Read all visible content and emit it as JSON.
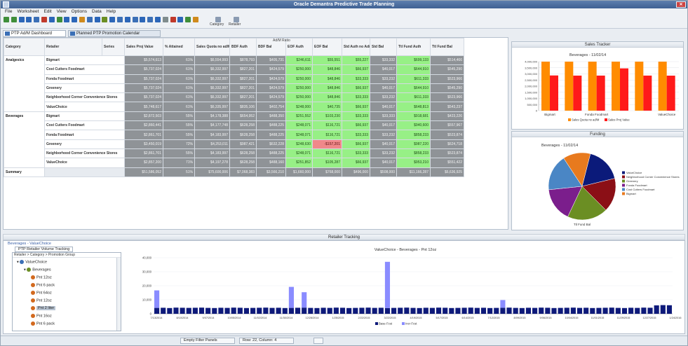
{
  "window": {
    "title": "Oracle Demantra Predictive Trade Planning"
  },
  "menu": [
    "File",
    "Worksheet",
    "Edit",
    "View",
    "Options",
    "Data",
    "Help"
  ],
  "toolbar": {
    "btn1_label": "Category",
    "btn2_label": "Retailer"
  },
  "doc_tabs": [
    {
      "label": "PTP Ad/M Dashboard",
      "active": true
    },
    {
      "label": "Planned PTP Promotion Calendar",
      "active": false
    }
  ],
  "crosstab": {
    "group_header": "Ad/M Ratio",
    "headers": [
      "Category",
      "Retailer",
      "Series",
      "Sales Proj Value",
      "% Attained",
      "Sales Quota no ad/M",
      "BDF Auth",
      "BDF Bal",
      "EOF Auth",
      "EOF Bal",
      "Std Auth no Ad/M",
      "Std Bal",
      "Ttl Fund Auth",
      "Ttl Fund Bal"
    ],
    "groups": [
      {
        "category": "Analgesics",
        "rows": [
          {
            "retailer": "Bigmart",
            "vals": [
              "$5,574,613",
              "61%",
              "$6,554,993",
              "$878,793",
              "$405,731",
              "$246,611",
              "$55,551",
              "$55,227",
              "$33,332",
              "$699,133",
              "$514,466"
            ]
          },
          {
            "retailer": "Cost Cutters Foodmart",
            "vals": [
              "$5,737,024",
              "61%",
              "$6,332,997",
              "$827,201",
              "$424,579",
              "$250,000",
              "$48,846",
              "$66,937",
              "$40,017",
              "$644,910",
              "$545,290"
            ]
          },
          {
            "retailer": "Fonda Foodmart",
            "vals": [
              "$5,737,024",
              "61%",
              "$6,332,997",
              "$827,201",
              "$424,579",
              "$250,000",
              "$48,846",
              "$33,333",
              "$33,232",
              "$611,333",
              "$523,966"
            ]
          },
          {
            "retailer": "Greenery",
            "vals": [
              "$5,737,024",
              "61%",
              "$6,332,997",
              "$827,201",
              "$424,579",
              "$250,000",
              "$48,846",
              "$66,937",
              "$40,017",
              "$644,910",
              "$545,290"
            ]
          },
          {
            "retailer": "Neighborhood Corner Convenience Stores",
            "vals": [
              "$5,737,024",
              "61%",
              "$6,332,997",
              "$827,201",
              "$424,579",
              "$250,000",
              "$48,846",
              "$33,333",
              "$33,232",
              "$611,333",
              "$523,966"
            ]
          },
          {
            "retailer": "ValueChoice",
            "vals": [
              "$5,748,617",
              "61%",
              "$6,335,997",
              "$835,106",
              "$402,754",
              "$248,000",
              "$40,735",
              "$66,937",
              "$40,017",
              "$648,813",
              "$543,237"
            ]
          }
        ]
      },
      {
        "category": "Beverages",
        "rows": [
          {
            "retailer": "Bigmart",
            "vals": [
              "$2,872,503",
              "55%",
              "$4,178,388",
              "$654,952",
              "$488,350",
              "$251,552",
              "$103,230",
              "$33,333",
              "$33,333",
              "$918,681",
              "$423,226"
            ]
          },
          {
            "retailer": "Cost Cutters Foodmart",
            "vals": [
              "$2,860,441",
              "55%",
              "$4,177,748",
              "$628,258",
              "$488,225",
              "$248,071",
              "$116,721",
              "$66,937",
              "$40,017",
              "$940,600",
              "$557,967"
            ]
          },
          {
            "retailer": "Fonda Foodmart",
            "vals": [
              "$2,861,701",
              "55%",
              "$4,183,997",
              "$628,258",
              "$488,225",
              "$248,071",
              "$116,721",
              "$33,333",
              "$33,232",
              "$858,233",
              "$523,874"
            ]
          },
          {
            "retailer": "Greenery",
            "vals": [
              "$3,450,019",
              "72%",
              "$4,253,011",
              "$987,421",
              "$632,228",
              "$248,630",
              "-$157,201",
              "$66,937",
              "$40,017",
              "$987,220",
              "$624,718"
            ]
          },
          {
            "retailer": "Neighborhood Corner Convenience Stores",
            "vals": [
              "$2,861,701",
              "55%",
              "$4,183,997",
              "$628,258",
              "$488,225",
              "$248,071",
              "$116,721",
              "$33,333",
              "$33,232",
              "$858,233",
              "$523,874"
            ]
          },
          {
            "retailer": "ValueChoice",
            "vals": [
              "$2,857,200",
              "71%",
              "$4,197,278",
              "$628,258",
              "$488,160",
              "$251,852",
              "$105,287",
              "$66,937",
              "$40,017",
              "$953,210",
              "$551,422"
            ]
          }
        ]
      }
    ],
    "summary": {
      "label": "Summary",
      "vals": [
        "$51,586,052",
        "51%",
        "$75,600,006",
        "$7,068,383",
        "$3,566,210",
        "$1,660,000",
        "$768,000",
        "$496,000",
        "$508,000",
        "$11,166,287",
        "$6,636,925"
      ]
    }
  },
  "sales_tracker": {
    "panel_title": "Sales Tracker",
    "chart_data": {
      "type": "bar",
      "title": "Beverages - 11/02/14",
      "categories": [
        "Bigmart",
        "",
        "Fonda Foodmart",
        "",
        "",
        "ValueChoice"
      ],
      "ylim": [
        0,
        4000000
      ],
      "yticks": [
        "4,000,000",
        "3,500,000",
        "3,000,000",
        "2,500,000",
        "2,000,000",
        "1,500,000",
        "1,000,000",
        "500,000",
        "0"
      ],
      "series": [
        {
          "name": "Sales Quota no ad/M",
          "color": "#ff8c00",
          "values": [
            4178388,
            4177748,
            4183997,
            4253011,
            4183997,
            4197278
          ]
        },
        {
          "name": "Sales Proj Value",
          "color": "#ff1a1a",
          "values": [
            2872503,
            2860441,
            2861701,
            3450019,
            2861701,
            2857200
          ]
        }
      ]
    }
  },
  "funding": {
    "panel_title": "Funding",
    "chart_data": {
      "type": "pie",
      "title": "Beverages - 11/02/14",
      "footer": "Ttl Fund Bal",
      "slices": [
        {
          "label": "ValueChoice",
          "value": 551422,
          "color": "#0b1a7a"
        },
        {
          "label": "Neighborhood Corner Convenience Stores",
          "value": 523874,
          "color": "#8b0f16"
        },
        {
          "label": "Greenery",
          "value": 624718,
          "color": "#6b8e23"
        },
        {
          "label": "Fonda Foodmart",
          "value": 523874,
          "color": "#7b1e8c"
        },
        {
          "label": "Cost Cutters Foodmart",
          "value": 557967,
          "color": "#4a86c5"
        },
        {
          "label": "Bigmart",
          "value": 423226,
          "color": "#e87a1e"
        }
      ]
    }
  },
  "lower": {
    "panel_title": "Retailer Tracking",
    "breadcrumb": "Beverages - ValueChoice",
    "tab_label": "PTP Retailer Volume Tracking",
    "tree_header": "Retailer > Category > Promotion Group",
    "tree": [
      {
        "label": "ValueChoice",
        "indent": 0,
        "color": "#3b6fb6"
      },
      {
        "label": "Beverages",
        "indent": 1,
        "color": "#6b8e23"
      },
      {
        "label": "Pnt 12oz",
        "indent": 2,
        "color": "#d2691e"
      },
      {
        "label": "Pnt 6 pack",
        "indent": 2,
        "color": "#d2691e"
      },
      {
        "label": "Pnt 64oz",
        "indent": 2,
        "color": "#d2691e"
      },
      {
        "label": "Pnt 12oz",
        "indent": 2,
        "color": "#d2691e"
      },
      {
        "label": "Pnt 2 liter",
        "indent": 2,
        "color": "#d2691e",
        "selected": true
      },
      {
        "label": "Pnt 16oz",
        "indent": 2,
        "color": "#d2691e"
      },
      {
        "label": "Pnt 6 pack",
        "indent": 2,
        "color": "#d2691e"
      }
    ],
    "chart_data": {
      "type": "bar",
      "title": "ValueChoice - Beverages - Pnt 12oz",
      "ylim": [
        0,
        40000
      ],
      "yticks": [
        "40,000",
        "30,000",
        "20,000",
        "10,000",
        "0"
      ],
      "xlabels": [
        "7/13/2014",
        "8/10/2014",
        "9/07/2014",
        "10/05/2014",
        "11/02/2014",
        "11/30/2014",
        "12/28/2014",
        "1/25/2015",
        "2/22/2015",
        "3/22/2015",
        "4/19/2015",
        "5/17/2015",
        "6/14/2015",
        "7/12/2015",
        "8/09/2015",
        "9/06/2015",
        "10/04/2015",
        "11/01/2015",
        "11/29/2015",
        "12/27/2015",
        "1/24/2016"
      ],
      "series": [
        {
          "name": "Base Fcst",
          "color": "#0e1a7a",
          "values": [
            4200,
            4300,
            4100,
            4400,
            4300,
            4200,
            4300,
            4400,
            4200,
            4100,
            4300,
            4200,
            4400,
            4300,
            4100,
            4200,
            4300,
            4400,
            4200,
            4300,
            4100,
            4200,
            4300,
            4400,
            4200,
            4100,
            4300,
            4200,
            4400,
            4300,
            4100,
            4200,
            4300,
            4400,
            4200,
            4300,
            4100,
            4200,
            4300,
            4400,
            4200,
            4100,
            4300,
            4200,
            4400,
            4300,
            4100,
            4200,
            4300,
            4400,
            4200,
            4300,
            4100,
            4200,
            4300,
            4400,
            4200,
            4100,
            4300,
            4200,
            4400,
            4300,
            4100,
            4200,
            4300,
            4400,
            4200,
            4300,
            4100,
            4200,
            4300,
            4400,
            4200,
            4100,
            4300,
            4200,
            4400,
            4300,
            6000,
            6200,
            6100
          ]
        },
        {
          "name": "Incr Fcst",
          "color": "#8a8cff",
          "values": [
            12500,
            0,
            0,
            0,
            0,
            0,
            0,
            0,
            0,
            0,
            0,
            0,
            0,
            0,
            0,
            0,
            0,
            0,
            0,
            0,
            0,
            15000,
            0,
            11000,
            0,
            0,
            0,
            0,
            0,
            0,
            0,
            0,
            0,
            0,
            0,
            0,
            33000,
            0,
            0,
            0,
            0,
            0,
            0,
            0,
            0,
            0,
            0,
            0,
            0,
            0,
            0,
            0,
            0,
            0,
            5500,
            0,
            0,
            0,
            0,
            0,
            0,
            0,
            0,
            0,
            0,
            0,
            0,
            0,
            0,
            0,
            0,
            0,
            0,
            0,
            0,
            0,
            0,
            0,
            0,
            0,
            0
          ]
        }
      ],
      "legend": [
        "Base Fcst",
        "Incr Fcst"
      ]
    }
  },
  "status": {
    "seg1": "Empty Filter Panels",
    "seg2": "Row: 22, Column: 4"
  }
}
